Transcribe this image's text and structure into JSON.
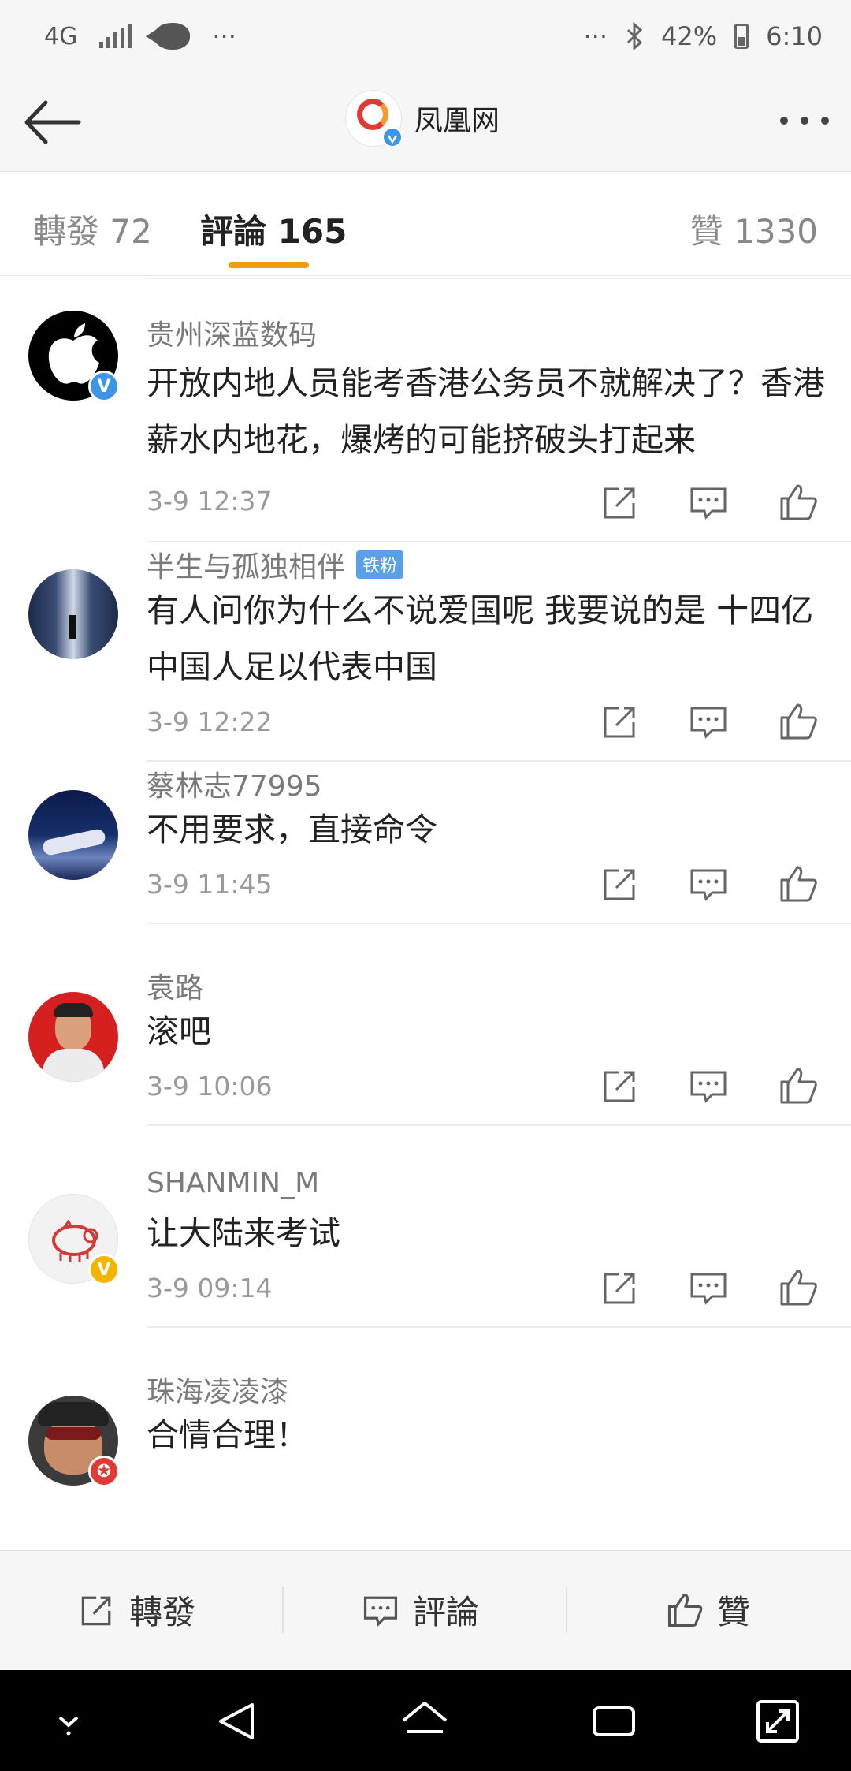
{
  "status_bar": {
    "network": "4G",
    "more": "···",
    "battery": "42%",
    "time": "6:10"
  },
  "nav": {
    "title": "凤凰网"
  },
  "tabs": [
    {
      "label": "轉發 72"
    },
    {
      "label": "評論 165"
    },
    {
      "label": "贊 1330"
    }
  ],
  "active_tab_color": "#f39a12",
  "comments": [
    {
      "user": "贵州深蓝数码",
      "badge": "verified-blue",
      "text": "开放内地人员能考香港公务员不就解决了？香港薪水内地花，爆烤的可能挤破头打起来",
      "time": "3-9 12:37"
    },
    {
      "user": "半生与孤独相伴",
      "tag": "铁粉",
      "text": "有人问你为什么不说爱国呢 我要说的是 十四亿中国人足以代表中国",
      "time": "3-9 12:22"
    },
    {
      "user": "蔡林志77995",
      "text": "不用要求，直接命令",
      "time": "3-9 11:45"
    },
    {
      "user": "袁路",
      "text": "滚吧",
      "time": "3-9 10:06"
    },
    {
      "user": "SHANMIN_M",
      "badge": "verified-yellow",
      "text": "让大陆来考试",
      "time": "3-9 09:14"
    },
    {
      "user": "珠海凌凌漆",
      "badge": "red",
      "text": "合情合理！",
      "time": ""
    }
  ],
  "bottom_bar": {
    "repost": "轉發",
    "comment": "評論",
    "like": "贊"
  }
}
